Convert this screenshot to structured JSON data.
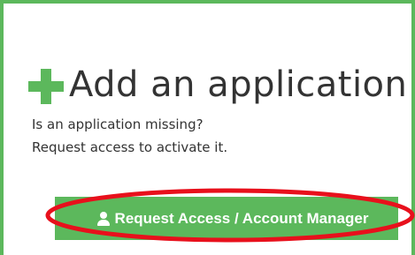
{
  "card": {
    "title": "Add an application",
    "description_line1": "Is an application missing?",
    "description_line2": "Request access to activate it.",
    "button_label": "Request Access / Account Manager"
  },
  "colors": {
    "accent_green": "#5cb85c",
    "highlight_red": "#e8101c",
    "text": "#333333"
  },
  "icons": {
    "title_icon": "plus-icon",
    "button_icon": "user-icon"
  }
}
